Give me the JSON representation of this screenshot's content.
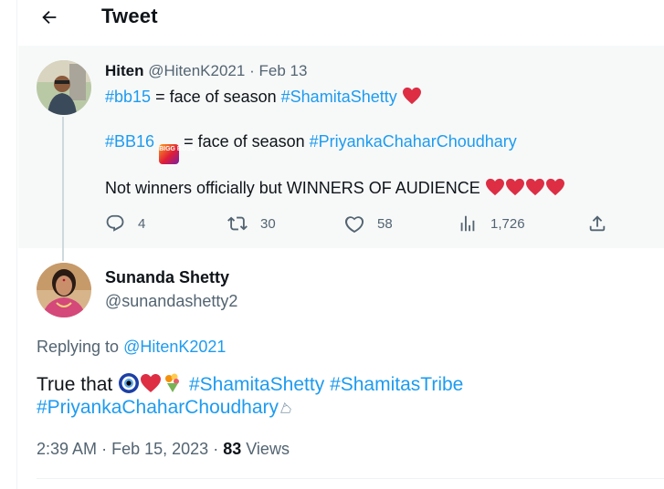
{
  "header": {
    "title": "Tweet"
  },
  "quoted": {
    "name": "Hiten",
    "handle": "@HitenK2021",
    "sep": "·",
    "date": "Feb 13",
    "line1_tag1": "#bb15",
    "line1_text": " = face of season ",
    "line1_tag2": "#ShamitaShetty",
    "line2_tag1": "#BB16",
    "line2_text": " = face of season ",
    "line2_tag2": "#PriyankaChaharChoudhary",
    "line3_text": "Not winners officially but WINNERS OF AUDIENCE",
    "stats": {
      "replies": "4",
      "retweets": "30",
      "likes": "58",
      "views": "1,726"
    },
    "bb_icon_text": "BIGG BOSS"
  },
  "reply": {
    "name": "Sunanda Shetty",
    "handle": "@sunandashetty2",
    "replying_prefix": "Replying to ",
    "replying_to": "@HitenK2021",
    "text_start": "True that ",
    "tag1": "#ShamitaShetty",
    "tag2": "#ShamitasTribe",
    "tag3": "#PriyankaChaharChoudhary",
    "time": "2:39 AM",
    "sep": "·",
    "date": "Feb 15, 2023",
    "views_count": "83",
    "views_label": "Views"
  },
  "colors": {
    "accent": "#1d9bf0",
    "heart": "#e0245e",
    "muted": "#536471"
  },
  "icons": [
    "back-arrow-icon",
    "reply-icon",
    "retweet-icon",
    "like-icon",
    "views-icon",
    "share-icon",
    "heart-emoji-icon",
    "nazar-emoji-icon",
    "bouquet-emoji-icon",
    "bigg-boss-logo-icon",
    "tiger-emoji-icon"
  ]
}
